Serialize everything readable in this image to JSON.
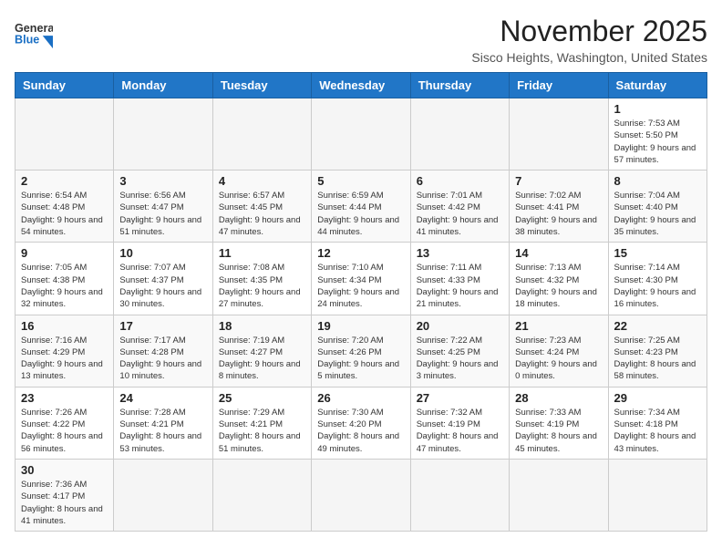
{
  "header": {
    "logo_text_general": "General",
    "logo_text_blue": "Blue",
    "month": "November 2025",
    "location": "Sisco Heights, Washington, United States"
  },
  "weekdays": [
    "Sunday",
    "Monday",
    "Tuesday",
    "Wednesday",
    "Thursday",
    "Friday",
    "Saturday"
  ],
  "weeks": [
    [
      {
        "day": "",
        "info": ""
      },
      {
        "day": "",
        "info": ""
      },
      {
        "day": "",
        "info": ""
      },
      {
        "day": "",
        "info": ""
      },
      {
        "day": "",
        "info": ""
      },
      {
        "day": "",
        "info": ""
      },
      {
        "day": "1",
        "info": "Sunrise: 7:53 AM\nSunset: 5:50 PM\nDaylight: 9 hours and 57 minutes."
      }
    ],
    [
      {
        "day": "2",
        "info": "Sunrise: 6:54 AM\nSunset: 4:48 PM\nDaylight: 9 hours and 54 minutes."
      },
      {
        "day": "3",
        "info": "Sunrise: 6:56 AM\nSunset: 4:47 PM\nDaylight: 9 hours and 51 minutes."
      },
      {
        "day": "4",
        "info": "Sunrise: 6:57 AM\nSunset: 4:45 PM\nDaylight: 9 hours and 47 minutes."
      },
      {
        "day": "5",
        "info": "Sunrise: 6:59 AM\nSunset: 4:44 PM\nDaylight: 9 hours and 44 minutes."
      },
      {
        "day": "6",
        "info": "Sunrise: 7:01 AM\nSunset: 4:42 PM\nDaylight: 9 hours and 41 minutes."
      },
      {
        "day": "7",
        "info": "Sunrise: 7:02 AM\nSunset: 4:41 PM\nDaylight: 9 hours and 38 minutes."
      },
      {
        "day": "8",
        "info": "Sunrise: 7:04 AM\nSunset: 4:40 PM\nDaylight: 9 hours and 35 minutes."
      }
    ],
    [
      {
        "day": "9",
        "info": "Sunrise: 7:05 AM\nSunset: 4:38 PM\nDaylight: 9 hours and 32 minutes."
      },
      {
        "day": "10",
        "info": "Sunrise: 7:07 AM\nSunset: 4:37 PM\nDaylight: 9 hours and 30 minutes."
      },
      {
        "day": "11",
        "info": "Sunrise: 7:08 AM\nSunset: 4:35 PM\nDaylight: 9 hours and 27 minutes."
      },
      {
        "day": "12",
        "info": "Sunrise: 7:10 AM\nSunset: 4:34 PM\nDaylight: 9 hours and 24 minutes."
      },
      {
        "day": "13",
        "info": "Sunrise: 7:11 AM\nSunset: 4:33 PM\nDaylight: 9 hours and 21 minutes."
      },
      {
        "day": "14",
        "info": "Sunrise: 7:13 AM\nSunset: 4:32 PM\nDaylight: 9 hours and 18 minutes."
      },
      {
        "day": "15",
        "info": "Sunrise: 7:14 AM\nSunset: 4:30 PM\nDaylight: 9 hours and 16 minutes."
      }
    ],
    [
      {
        "day": "16",
        "info": "Sunrise: 7:16 AM\nSunset: 4:29 PM\nDaylight: 9 hours and 13 minutes."
      },
      {
        "day": "17",
        "info": "Sunrise: 7:17 AM\nSunset: 4:28 PM\nDaylight: 9 hours and 10 minutes."
      },
      {
        "day": "18",
        "info": "Sunrise: 7:19 AM\nSunset: 4:27 PM\nDaylight: 9 hours and 8 minutes."
      },
      {
        "day": "19",
        "info": "Sunrise: 7:20 AM\nSunset: 4:26 PM\nDaylight: 9 hours and 5 minutes."
      },
      {
        "day": "20",
        "info": "Sunrise: 7:22 AM\nSunset: 4:25 PM\nDaylight: 9 hours and 3 minutes."
      },
      {
        "day": "21",
        "info": "Sunrise: 7:23 AM\nSunset: 4:24 PM\nDaylight: 9 hours and 0 minutes."
      },
      {
        "day": "22",
        "info": "Sunrise: 7:25 AM\nSunset: 4:23 PM\nDaylight: 8 hours and 58 minutes."
      }
    ],
    [
      {
        "day": "23",
        "info": "Sunrise: 7:26 AM\nSunset: 4:22 PM\nDaylight: 8 hours and 56 minutes."
      },
      {
        "day": "24",
        "info": "Sunrise: 7:28 AM\nSunset: 4:21 PM\nDaylight: 8 hours and 53 minutes."
      },
      {
        "day": "25",
        "info": "Sunrise: 7:29 AM\nSunset: 4:21 PM\nDaylight: 8 hours and 51 minutes."
      },
      {
        "day": "26",
        "info": "Sunrise: 7:30 AM\nSunset: 4:20 PM\nDaylight: 8 hours and 49 minutes."
      },
      {
        "day": "27",
        "info": "Sunrise: 7:32 AM\nSunset: 4:19 PM\nDaylight: 8 hours and 47 minutes."
      },
      {
        "day": "28",
        "info": "Sunrise: 7:33 AM\nSunset: 4:19 PM\nDaylight: 8 hours and 45 minutes."
      },
      {
        "day": "29",
        "info": "Sunrise: 7:34 AM\nSunset: 4:18 PM\nDaylight: 8 hours and 43 minutes."
      }
    ],
    [
      {
        "day": "30",
        "info": "Sunrise: 7:36 AM\nSunset: 4:17 PM\nDaylight: 8 hours and 41 minutes."
      },
      {
        "day": "",
        "info": ""
      },
      {
        "day": "",
        "info": ""
      },
      {
        "day": "",
        "info": ""
      },
      {
        "day": "",
        "info": ""
      },
      {
        "day": "",
        "info": ""
      },
      {
        "day": "",
        "info": ""
      }
    ]
  ]
}
